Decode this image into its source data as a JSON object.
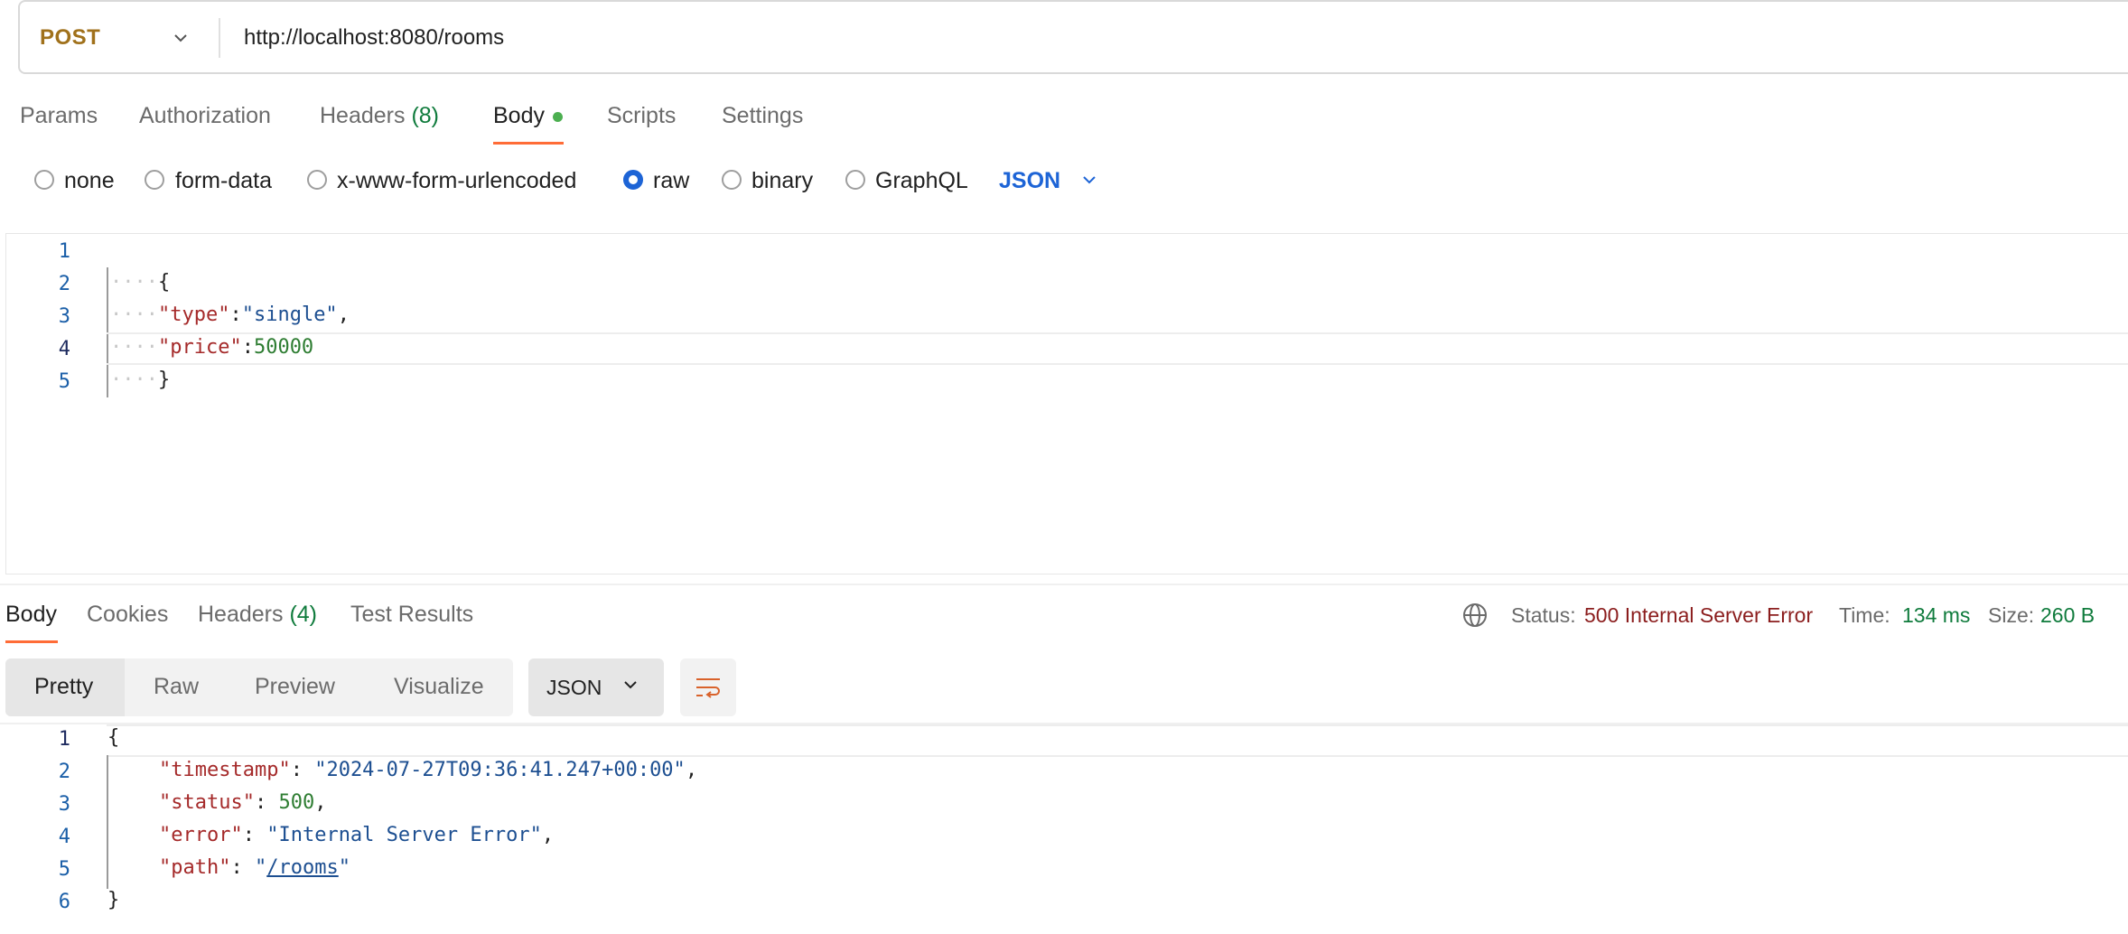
{
  "request": {
    "method": "POST",
    "url": "http://localhost:8080/rooms"
  },
  "request_tabs": {
    "params": "Params",
    "authorization": "Authorization",
    "headers": "Headers",
    "headers_count": "(8)",
    "body": "Body",
    "scripts": "Scripts",
    "settings": "Settings"
  },
  "body_types": {
    "none": "none",
    "form_data": "form-data",
    "urlencoded": "x-www-form-urlencoded",
    "raw": "raw",
    "binary": "binary",
    "graphql": "GraphQL",
    "selected": "raw",
    "language": "JSON"
  },
  "request_body": {
    "line_numbers": [
      "1",
      "2",
      "3",
      "4",
      "5"
    ],
    "dots": "····",
    "open_brace": "{",
    "type_key": "\"type\"",
    "type_value": "\"single\"",
    "price_key": "\"price\"",
    "price_value": "50000",
    "close_brace": "}",
    "colon": ":",
    "comma": ","
  },
  "response_tabs": {
    "body": "Body",
    "cookies": "Cookies",
    "headers": "Headers",
    "headers_count": "(4)",
    "test_results": "Test Results"
  },
  "response_status": {
    "status_label": "Status:",
    "status_value": "500 Internal Server Error",
    "time_label": "Time:",
    "time_value": "134 ms",
    "size_label": "Size:",
    "size_value": "260 B"
  },
  "response_view": {
    "modes": [
      "Pretty",
      "Raw",
      "Preview",
      "Visualize"
    ],
    "active_mode": "Pretty",
    "format": "JSON"
  },
  "response_body": {
    "line_numbers": [
      "1",
      "2",
      "3",
      "4",
      "5",
      "6"
    ],
    "open_brace": "{",
    "timestamp_key": "\"timestamp\"",
    "timestamp_value": "\"2024-07-27T09:36:41.247+00:00\"",
    "status_key": "\"status\"",
    "status_value": "500",
    "error_key": "\"error\"",
    "error_value": "\"Internal Server Error\"",
    "path_key": "\"path\"",
    "path_quote": "\"",
    "path_value": "/rooms",
    "close_brace": "}",
    "colon_space": ": ",
    "comma": ","
  },
  "colors": {
    "method": "#a0711b",
    "accent": "#ff6c37",
    "link_blue": "#1d64d6",
    "success": "#0f7b3c",
    "error": "#8b1d1d"
  }
}
